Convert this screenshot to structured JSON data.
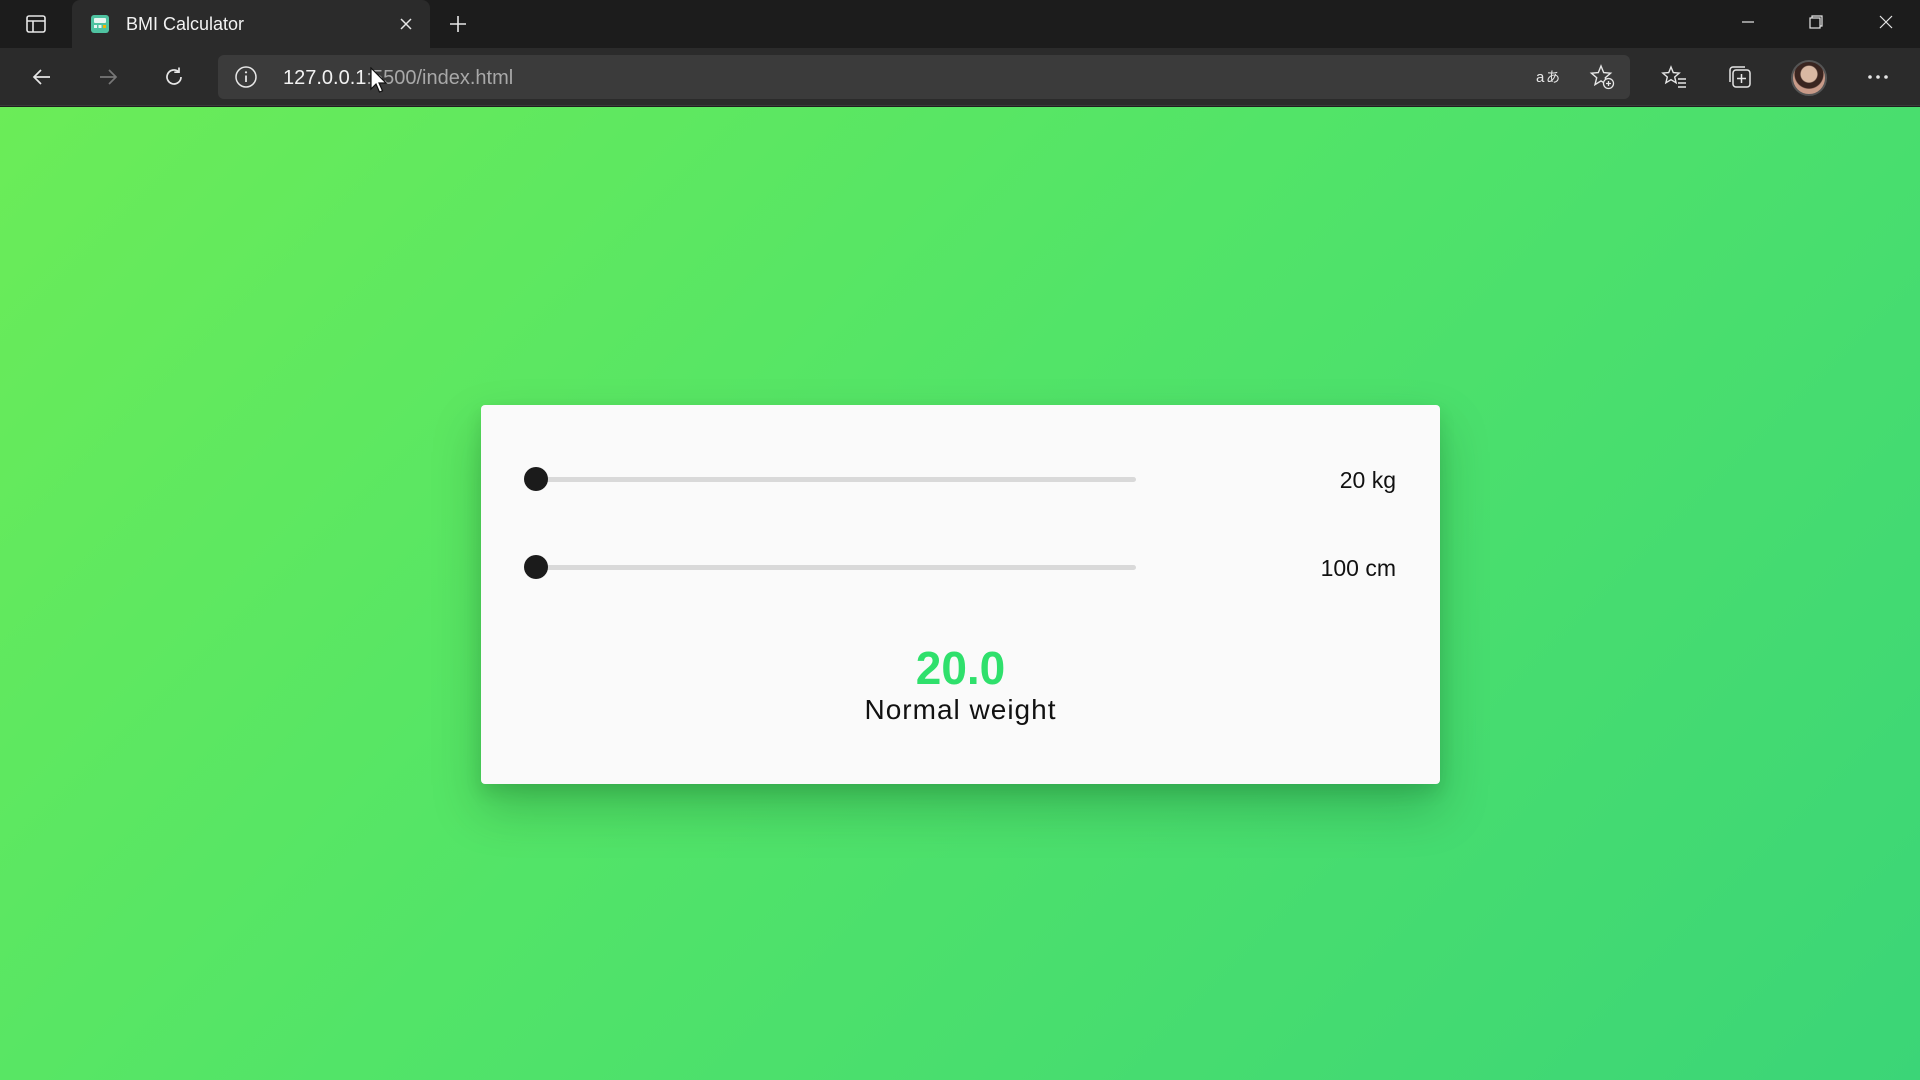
{
  "browser": {
    "tab": {
      "title": "BMI Calculator"
    },
    "address": {
      "url_host": "127.0.0.1",
      "url_path": ":5500/index.html"
    }
  },
  "app": {
    "weight": {
      "value": 20,
      "label": "20 kg"
    },
    "height": {
      "value": 100,
      "label": "100 cm"
    },
    "result": {
      "bmi": "20.0",
      "category": "Normal weight"
    }
  },
  "colors": {
    "accent": "#2fe06c",
    "background_start": "#6bec58",
    "background_end": "#3bd577"
  },
  "icons": {
    "tab_actions": "tab-actions-icon",
    "favicon": "bmi-favicon-icon",
    "close": "close-icon",
    "new_tab": "plus-icon",
    "back": "back-arrow-icon",
    "forward": "forward-arrow-icon",
    "refresh": "refresh-icon",
    "info": "info-icon",
    "read_aloud": "read-aloud-icon",
    "add_favorite": "star-add-icon",
    "favorites": "favorites-icon",
    "collections": "collections-icon",
    "more": "more-icon"
  }
}
